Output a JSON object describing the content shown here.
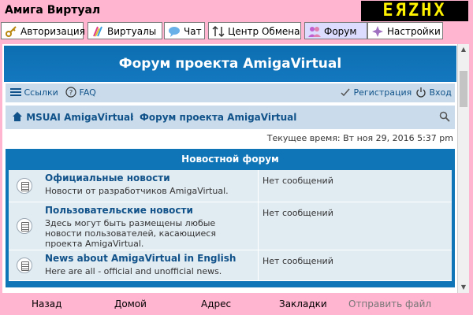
{
  "window": {
    "title": "Амига Виртуал",
    "logo_text": "ЕЯZНХ"
  },
  "nav": [
    {
      "label": "Авторизация",
      "icon": "key-icon"
    },
    {
      "label": "Виртуалы",
      "icon": "paint-brush-icon"
    },
    {
      "label": "Чат",
      "icon": "chat-bubble-icon"
    },
    {
      "label": "Центр Обмена",
      "icon": "transfer-arrows-icon"
    },
    {
      "label": "Форум",
      "icon": "users-icon",
      "active": true
    },
    {
      "label": "Настройки",
      "icon": "settings-star-icon"
    }
  ],
  "forum": {
    "header": "Форум проекта AmigaVirtual",
    "links": {
      "links": "Ссылки",
      "faq": "FAQ",
      "register": "Регистрация",
      "login": "Вход"
    },
    "breadcrumb": {
      "root": "MSUAI AmigaVirtual",
      "sep": "‹",
      "current": "Форум проекта AmigaVirtual"
    },
    "current_time": "Текущее время: Вт ноя 29, 2016 5:37 pm",
    "section_title": "Новостной форум",
    "rows": [
      {
        "title": "Официальные новости",
        "desc": "Новости от разработчиков AmigaVirtual.",
        "last": "Нет сообщений"
      },
      {
        "title": "Пользовательские новости",
        "desc": "Здесь могут быть размещены любые новости пользователей, касающиеся проекта AmigaVirtual.",
        "last": "Нет сообщений"
      },
      {
        "title": "News about AmigaVirtual in English",
        "desc": "Here are all - official and unofficial news.",
        "last": "Нет сообщений"
      }
    ]
  },
  "bottom": {
    "back": "Назад",
    "home": "Домой",
    "address": "Адрес",
    "bookmarks": "Закладки",
    "send_file": "Отправить файл"
  },
  "colors": {
    "background": "#ffb4cf",
    "forum_blue": "#0f75b6",
    "link_blue": "#105289",
    "row_bg": "#e1ebf2"
  }
}
